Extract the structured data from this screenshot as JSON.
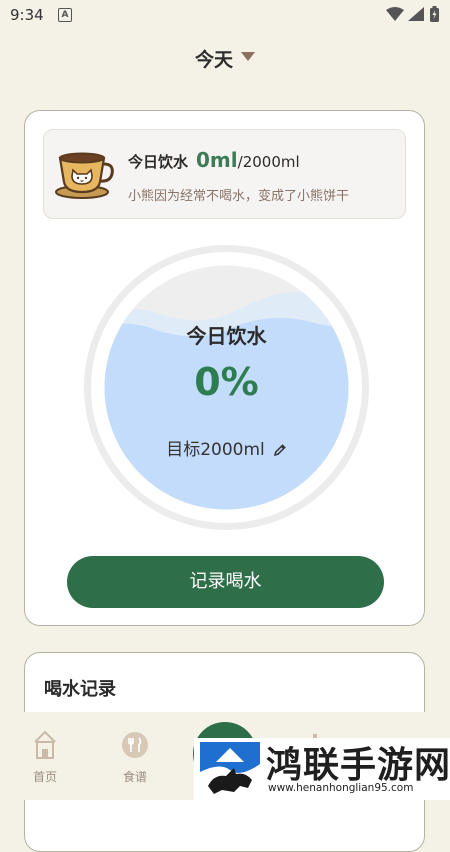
{
  "status_bar": {
    "time": "9:34",
    "notif_letter": "A"
  },
  "header": {
    "title": "今天"
  },
  "intake_info": {
    "label": "今日饮水",
    "amount": "0ml",
    "target": "/2000ml",
    "message": "小熊因为经常不喝水，变成了小熊饼干"
  },
  "gauge": {
    "title": "今日饮水",
    "percent_text": "0%",
    "goal_text": "目标2000ml",
    "fill_fraction": 0.0
  },
  "record_button": {
    "label": "记录喝水"
  },
  "history": {
    "title": "喝水记录"
  },
  "bottom_nav": {
    "items": [
      {
        "label": "首页",
        "icon": "home-icon"
      },
      {
        "label": "食谱",
        "icon": "recipe-icon"
      }
    ]
  },
  "watermark": {
    "title": "鸿联手游网",
    "url": "www.henanhonglian95.com"
  },
  "colors": {
    "accent": "#2e6e49",
    "water": "#c4dcfb",
    "background": "#f4f1e6"
  }
}
